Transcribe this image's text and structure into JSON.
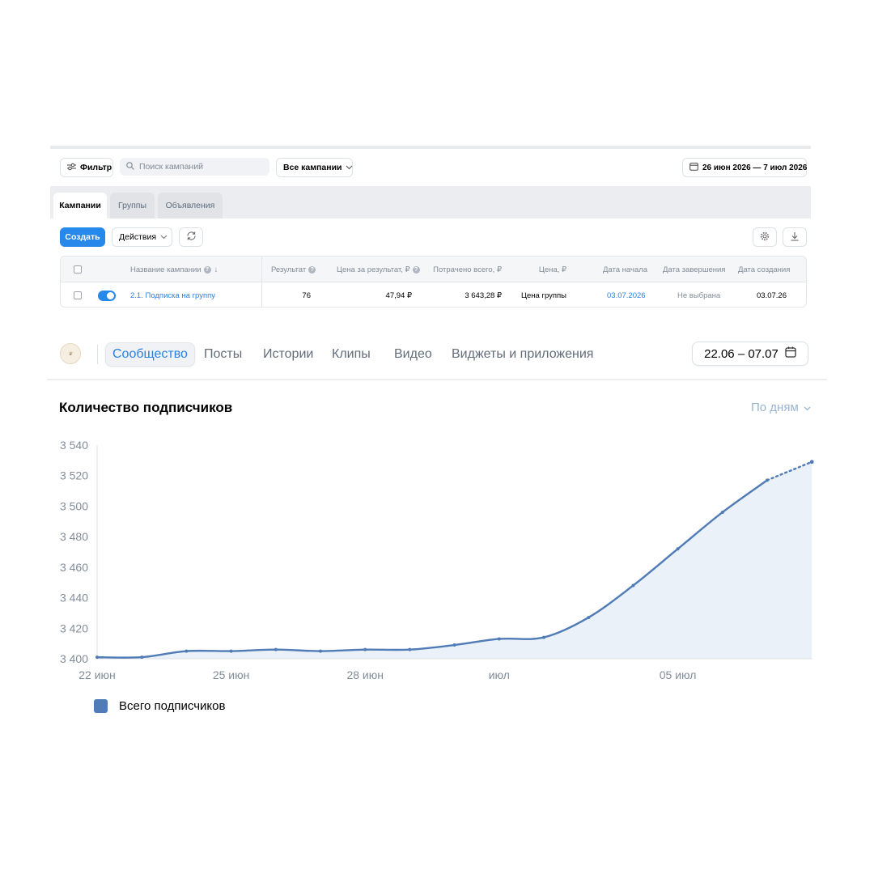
{
  "ads": {
    "filter_label": "Фильтр",
    "search_placeholder": "Поиск кампаний",
    "all_campaigns_label": "Все кампании",
    "date_range": "26 июн 2026 — 7 июл 2026",
    "tabs": [
      {
        "label": "Кампании",
        "active": true
      },
      {
        "label": "Группы",
        "active": false
      },
      {
        "label": "Объявления",
        "active": false
      }
    ],
    "create_label": "Создать",
    "actions_label": "Действия",
    "table": {
      "headers": {
        "name": "Название кампании",
        "result": "Результат",
        "price_per_result": "Цена за результат, ₽",
        "spent_total": "Потрачено всего, ₽",
        "price": "Цена, ₽",
        "start_date": "Дата начала",
        "end_date": "Дата завершения",
        "created_date": "Дата создания"
      },
      "rows": [
        {
          "enabled": true,
          "name": "2.1. Подписка на группу",
          "result": "76",
          "price_per_result": "47,94 ₽",
          "spent_total": "3 643,28 ₽",
          "price": "Цена группы",
          "start_date": "03.07.2026",
          "end_date": "Не выбрана",
          "created_date": "03.07.26"
        }
      ]
    }
  },
  "stats": {
    "nav_tabs": [
      {
        "label": "Сообщество",
        "active": true
      },
      {
        "label": "Посты",
        "active": false
      },
      {
        "label": "Истории",
        "active": false
      },
      {
        "label": "Клипы",
        "active": false
      },
      {
        "label": "Видео",
        "active": false
      },
      {
        "label": "Виджеты и приложения",
        "active": false
      }
    ],
    "period": "22.06 – 07.07",
    "chart_title": "Количество подписчиков",
    "granularity": "По дням",
    "legend_label": "Всего подписчиков",
    "accent_color": "#2d81e0",
    "series_color": "#4f7bb6"
  },
  "chart_data": {
    "type": "area",
    "title": "Количество подписчиков",
    "xlabel": "",
    "ylabel": "",
    "ylim": [
      3400,
      3540
    ],
    "y_ticks": [
      "3 400",
      "3 420",
      "3 440",
      "3 460",
      "3 480",
      "3 500",
      "3 520",
      "3 540"
    ],
    "x_tick_labels": [
      {
        "date": "2026-06-22",
        "label": "22 июн"
      },
      {
        "date": "2026-06-25",
        "label": "25 июн"
      },
      {
        "date": "2026-06-28",
        "label": "28 июн"
      },
      {
        "date": "2026-07-01",
        "label": "июл"
      },
      {
        "date": "2026-07-05",
        "label": "05 июл"
      }
    ],
    "grid": false,
    "legend_position": "bottom-left",
    "series": [
      {
        "name": "Всего подписчиков",
        "x": [
          "2026-06-22",
          "2026-06-23",
          "2026-06-24",
          "2026-06-25",
          "2026-06-26",
          "2026-06-27",
          "2026-06-28",
          "2026-06-29",
          "2026-06-30",
          "2026-07-01",
          "2026-07-02",
          "2026-07-03",
          "2026-07-04",
          "2026-07-05",
          "2026-07-06",
          "2026-07-07"
        ],
        "values": [
          3401,
          3401,
          3405,
          3405,
          3406,
          3405,
          3406,
          3406,
          3409,
          3413,
          3414,
          3427,
          3448,
          3472,
          3496,
          3517
        ],
        "projected_next": 3529
      }
    ]
  }
}
